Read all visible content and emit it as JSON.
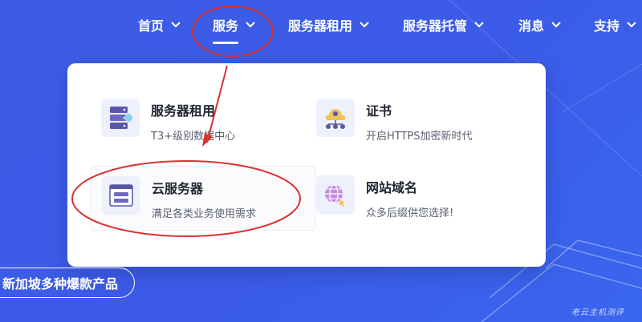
{
  "nav": {
    "items": [
      {
        "label": "首页"
      },
      {
        "label": "服务"
      },
      {
        "label": "服务器租用"
      },
      {
        "label": "服务器托管"
      },
      {
        "label": "消息"
      },
      {
        "label": "支持"
      }
    ]
  },
  "dropdown": {
    "cards": [
      {
        "title": "服务器租用",
        "desc": "T3+级别数据中心"
      },
      {
        "title": "证书",
        "desc": "开启HTTPS加密新时代"
      },
      {
        "title": "云服务器",
        "desc": "满足各类业务使用需求"
      },
      {
        "title": "网站域名",
        "desc": "众多后缀供您选择!"
      }
    ]
  },
  "hero": {
    "pill_label": "新加坡多种爆款产品"
  },
  "watermark": "老云主机测评",
  "colors": {
    "background": "#3d5ce6",
    "annotation": "#d9322f",
    "panel": "#ffffff"
  }
}
